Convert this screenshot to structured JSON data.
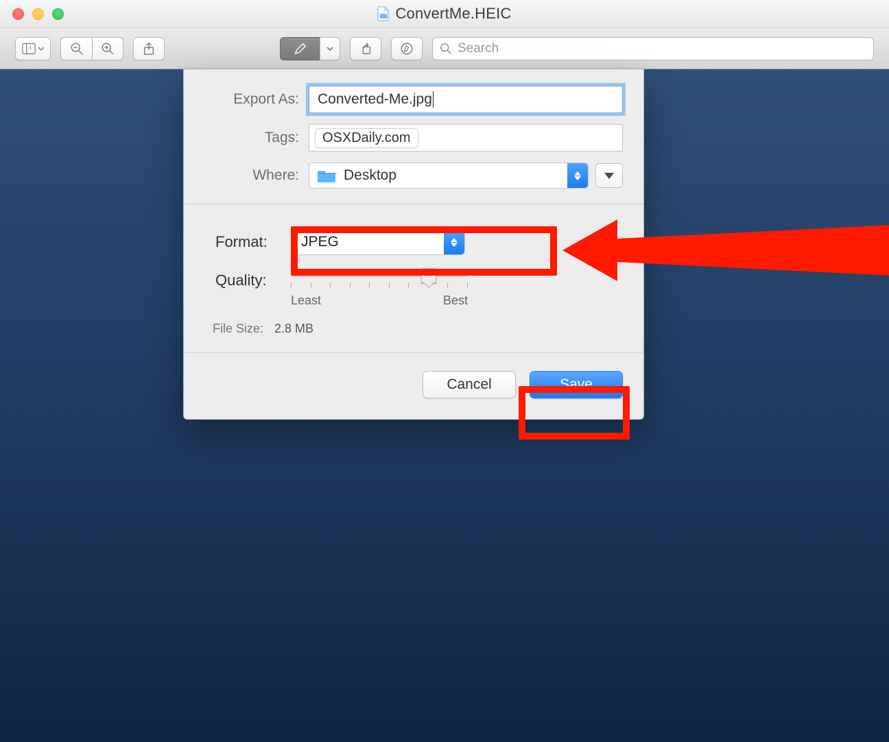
{
  "window": {
    "title": "ConvertMe.HEIC"
  },
  "toolbar": {
    "search_placeholder": "Search"
  },
  "export": {
    "export_as_label": "Export As:",
    "export_as_value": "Converted-Me.jpg",
    "tags_label": "Tags:",
    "tags_value": "OSXDaily.com",
    "where_label": "Where:",
    "where_value": "Desktop",
    "format_label": "Format:",
    "format_value": "JPEG",
    "quality_label": "Quality:",
    "quality_least": "Least",
    "quality_best": "Best",
    "quality_position_percent": 78,
    "filesize_label": "File Size:",
    "filesize_value": "2.8 MB",
    "cancel_label": "Cancel",
    "save_label": "Save"
  },
  "annotations": {
    "colors": {
      "highlight": "#ff1a00"
    }
  }
}
